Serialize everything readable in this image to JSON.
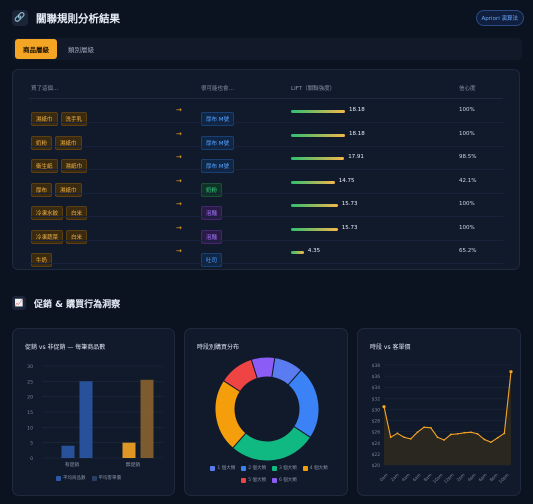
{
  "header": {
    "title": "關聯規則分析結果",
    "badge": "Apriori 演算法",
    "icon": "link-icon"
  },
  "tabs": [
    {
      "label": "商品層級",
      "active": true
    },
    {
      "label": "類別層級",
      "active": false
    }
  ],
  "rules_table": {
    "columns": [
      "買了這個…",
      "很可能也會…",
      "LIFT（關聯強度）",
      "信心度"
    ],
    "rows": [
      {
        "antecedents": [
          "濕紙巾",
          "洗手乳"
        ],
        "consequent": "厚布 M號",
        "lift": "18.18",
        "confidence": "100%",
        "color": "blue"
      },
      {
        "antecedents": [
          "奶粉",
          "濕紙巾"
        ],
        "consequent": "厚布 M號",
        "lift": "18.18",
        "confidence": "100%",
        "color": "blue"
      },
      {
        "antecedents": [
          "衛生紙",
          "濕紙巾"
        ],
        "consequent": "厚布 M號",
        "lift": "17.91",
        "confidence": "98.5%",
        "color": "blue"
      },
      {
        "antecedents": [
          "厚布",
          "濕紙巾"
        ],
        "consequent": "奶粉",
        "lift": "14.75",
        "confidence": "42.1%",
        "color": "green"
      },
      {
        "antecedents": [
          "冷凍水餃",
          "白米"
        ],
        "consequent": "泡麵",
        "lift": "15.73",
        "confidence": "100%",
        "color": "purple"
      },
      {
        "antecedents": [
          "冷凍蔬菜",
          "白米"
        ],
        "consequent": "泡麵",
        "lift": "15.73",
        "confidence": "100%",
        "color": "purple"
      },
      {
        "antecedents": [
          "牛奶"
        ],
        "consequent": "吐司",
        "lift": "4.35",
        "confidence": "65.2%",
        "color": "blue"
      }
    ],
    "lift_max": 18.18
  },
  "section": {
    "title": "促銷 & 購買行為洞察",
    "icon": "chart-icon"
  },
  "charts": {
    "promo": {
      "title": "促銷 vs 非促銷 — 每筆商品數"
    },
    "hourly_dist": {
      "title": "時段別購買分布"
    },
    "hourly_price": {
      "title": "時段 vs 客單價"
    }
  },
  "chart_data": [
    {
      "type": "bar",
      "title": "促銷 vs 非促銷 — 每筆商品數",
      "categories": [
        "有促銷",
        "無促銷"
      ],
      "series": [
        {
          "name": "平均商品數",
          "values": [
            4,
            5
          ],
          "color": "#f5a524"
        },
        {
          "name": "平均客單價",
          "values": [
            25,
            25.5
          ],
          "color": "#2b58a8"
        }
      ],
      "y_ticks": [
        "0",
        "5",
        "10",
        "15",
        "20",
        "25",
        "30"
      ],
      "ylim": [
        0,
        30
      ]
    },
    {
      "type": "pie",
      "title": "時段別購買分布",
      "labels": [
        "1 個大類",
        "2 個大類",
        "3 個大類",
        "4 個大類",
        "5 個大類",
        "6 個大類"
      ],
      "values": [
        10,
        25,
        30,
        25,
        12,
        8
      ],
      "colors": [
        "#5b7bf0",
        "#3b82f6",
        "#10b981",
        "#f59e0b",
        "#ef4444",
        "#8b5cf6"
      ]
    },
    {
      "type": "line",
      "title": "時段 vs 客單價",
      "x": [
        "0am",
        "2am",
        "4am",
        "6am",
        "8am",
        "10am",
        "12pm",
        "2pm",
        "4pm",
        "6pm",
        "8pm",
        "10pm"
      ],
      "y_points": [
        30.5,
        25.0,
        25.7,
        25.0,
        24.7,
        25.9,
        26.8,
        26.7,
        25.0,
        24.5,
        25.5,
        25.6,
        25.8,
        25.9,
        25.6,
        24.6,
        24.1,
        24.9,
        25.7,
        36.8
      ],
      "y_ticks": [
        "$20",
        "$22",
        "$24",
        "$26",
        "$28",
        "$30",
        "$32",
        "$34",
        "$36",
        "$38"
      ],
      "ylim": [
        20,
        38
      ]
    }
  ]
}
